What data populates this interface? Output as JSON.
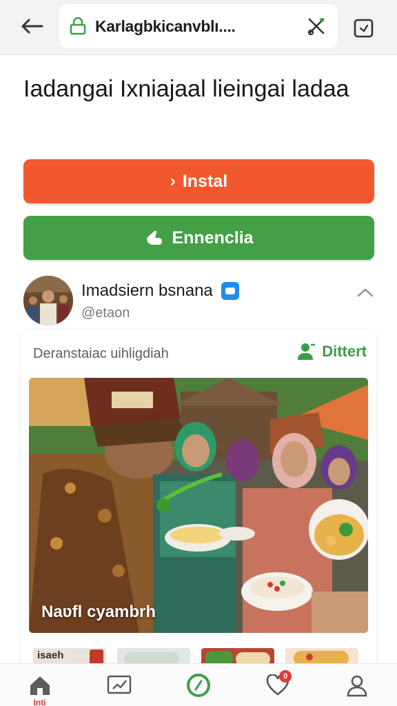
{
  "browser": {
    "url": "Karlagbkicanvblı....",
    "back_icon": "arrow-left-icon",
    "lock_icon": "lock-icon",
    "action_icon": "scissors-icon",
    "tabs_icon": "tabs-icon"
  },
  "page": {
    "title": "Iadangai Ixniajaal lieingai ladaa"
  },
  "buttons": {
    "install_label": "Instal",
    "download_label": "Ennenclia",
    "install_color": "#f2582e",
    "download_color": "#43a047"
  },
  "profile": {
    "name": "Imadsiern bsnana",
    "handle": "@etaon",
    "verified_color": "#1d8cf0"
  },
  "post": {
    "caption": "Deranstaiac uihligdiah",
    "follow_label": "Dittert",
    "photo_caption": "Naʋfl cyambrh"
  },
  "thumbnails": [
    {
      "label": "isaeh"
    },
    {
      "label": ""
    },
    {
      "label": ""
    },
    {
      "label": ""
    }
  ],
  "bottom_nav": {
    "items": [
      {
        "icon": "home-icon",
        "label": "Inti"
      },
      {
        "icon": "chart-icon",
        "label": ""
      },
      {
        "icon": "compass-icon",
        "label": ""
      },
      {
        "icon": "heart-icon",
        "label": "",
        "badge": "0"
      },
      {
        "icon": "profile-icon",
        "label": ""
      }
    ]
  }
}
